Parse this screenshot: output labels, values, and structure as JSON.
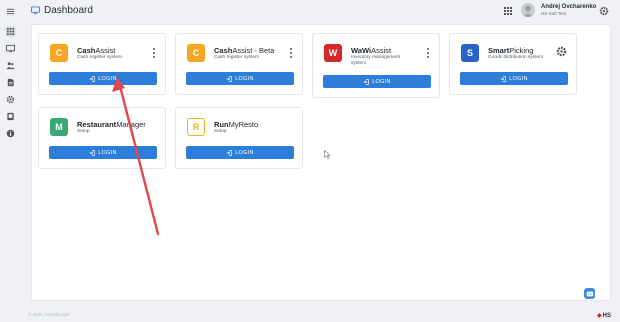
{
  "header": {
    "title": "Dashboard",
    "user_name": "Andrej Ovcharenko",
    "user_company": "HS-Soft Test"
  },
  "sidebar": {
    "items": [
      {
        "icon": "menu-icon"
      },
      {
        "icon": "apps-grid-icon",
        "active": true
      },
      {
        "icon": "monitor-icon"
      },
      {
        "icon": "users-icon"
      },
      {
        "icon": "document-icon"
      },
      {
        "icon": "settings-icon"
      },
      {
        "icon": "book-icon"
      },
      {
        "icon": "info-icon"
      }
    ]
  },
  "apps": [
    {
      "name_bold": "Cash",
      "name_rest": "Assist",
      "subtitle": "Cash register system",
      "subtitle2": "",
      "login_label": "LOGIN",
      "logo_letter": "C",
      "logo_color": "#f5a623",
      "menu": "kebab"
    },
    {
      "name_bold": "Cash",
      "name_rest": "Assist - Beta",
      "subtitle": "Cash register system",
      "subtitle2": "",
      "login_label": "LOGIN",
      "logo_letter": "C",
      "logo_color": "#f5a623",
      "menu": "kebab"
    },
    {
      "name_bold": "WaWi",
      "name_rest": "Assist",
      "subtitle": "Inventory management",
      "subtitle2": "system",
      "login_label": "LOGIN",
      "logo_letter": "W",
      "logo_color": "#d42a2a",
      "menu": "kebab"
    },
    {
      "name_bold": "Smart",
      "name_rest": "Picking",
      "subtitle": "Goods distribution system",
      "subtitle2": "",
      "login_label": "LOGIN",
      "logo_letter": "S",
      "logo_color": "#2b62c9",
      "menu": "gear"
    },
    {
      "name_bold": "Restaurant",
      "name_rest": "Manager",
      "subtitle": "Setup",
      "subtitle2": "",
      "login_label": "LOGIN",
      "logo_letter": "M",
      "logo_color": "#3aa874",
      "menu": ""
    },
    {
      "name_bold": "Run",
      "name_rest": "MyResto",
      "subtitle": "Setup",
      "subtitle2": "",
      "login_label": "LOGIN",
      "logo_letter": "R",
      "logo_color": "#f2b01e",
      "menu": ""
    }
  ],
  "footer": {
    "copyright": "© 2025, hessoft.com",
    "brand": "HS"
  },
  "colors": {
    "primary": "#2d7ed9",
    "annotation_arrow": "#e0474c"
  }
}
